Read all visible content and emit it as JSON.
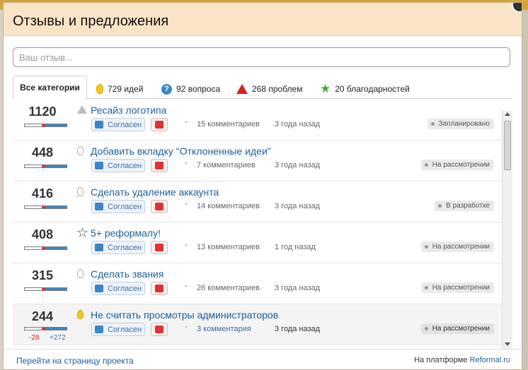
{
  "modal": {
    "title": "Отзывы и предложения"
  },
  "search": {
    "placeholder": "Ваш отзыв..."
  },
  "tabs": [
    {
      "label": "Все категории",
      "icon": "none"
    },
    {
      "label": "729 идей",
      "icon": "bulb-icon"
    },
    {
      "label": "92 вопроса",
      "icon": "question-icon"
    },
    {
      "label": "268 проблем",
      "icon": "warning-icon"
    },
    {
      "label": "20 благодарностей",
      "icon": "star-icon"
    }
  ],
  "items": [
    {
      "score": "1120",
      "title": "Ресайз логотипа",
      "comments": "15 комментариев",
      "date": "3 года назад",
      "status": "Запланировано",
      "type": "warning-icon"
    },
    {
      "score": "448",
      "title": "Добавить вкладку \"Отклоненные идеи\"",
      "comments": "7 комментариев",
      "date": "3 года назад",
      "status": "На рассмотрении",
      "type": "bulb-icon"
    },
    {
      "score": "416",
      "title": "Сделать удаление аккаунта",
      "comments": "14 комментариев",
      "date": "3 года назад",
      "status": "В разработке",
      "type": "bulb-icon"
    },
    {
      "score": "408",
      "title": "5+ реформалу!",
      "comments": "13 комментариев",
      "date": "1 год назад",
      "status": "На рассмотрении",
      "type": "star-icon"
    },
    {
      "score": "315",
      "title": "Сделать звания",
      "comments": "26 комментариев",
      "date": "3 года назад",
      "status": "На рассмотрении",
      "type": "bulb-icon"
    },
    {
      "score": "244",
      "title": "Не считать просмотры администраторов",
      "comments": "3 комментария",
      "date": "3 года назад",
      "status": "На рассмотрении",
      "type": "bulb-icon",
      "votes_neg": "-28",
      "votes_pos": "+272"
    }
  ],
  "agree_label": "Согласен",
  "footer": {
    "project_link": "Перейти на страницу проекта",
    "platform_label": "На платформе",
    "platform_link": "Reformal.ru"
  },
  "colors": {
    "header_bg": "#fbe4c5",
    "link": "#1a5e9e",
    "accent_blue": "#3a86c8",
    "accent_red": "#d33"
  }
}
